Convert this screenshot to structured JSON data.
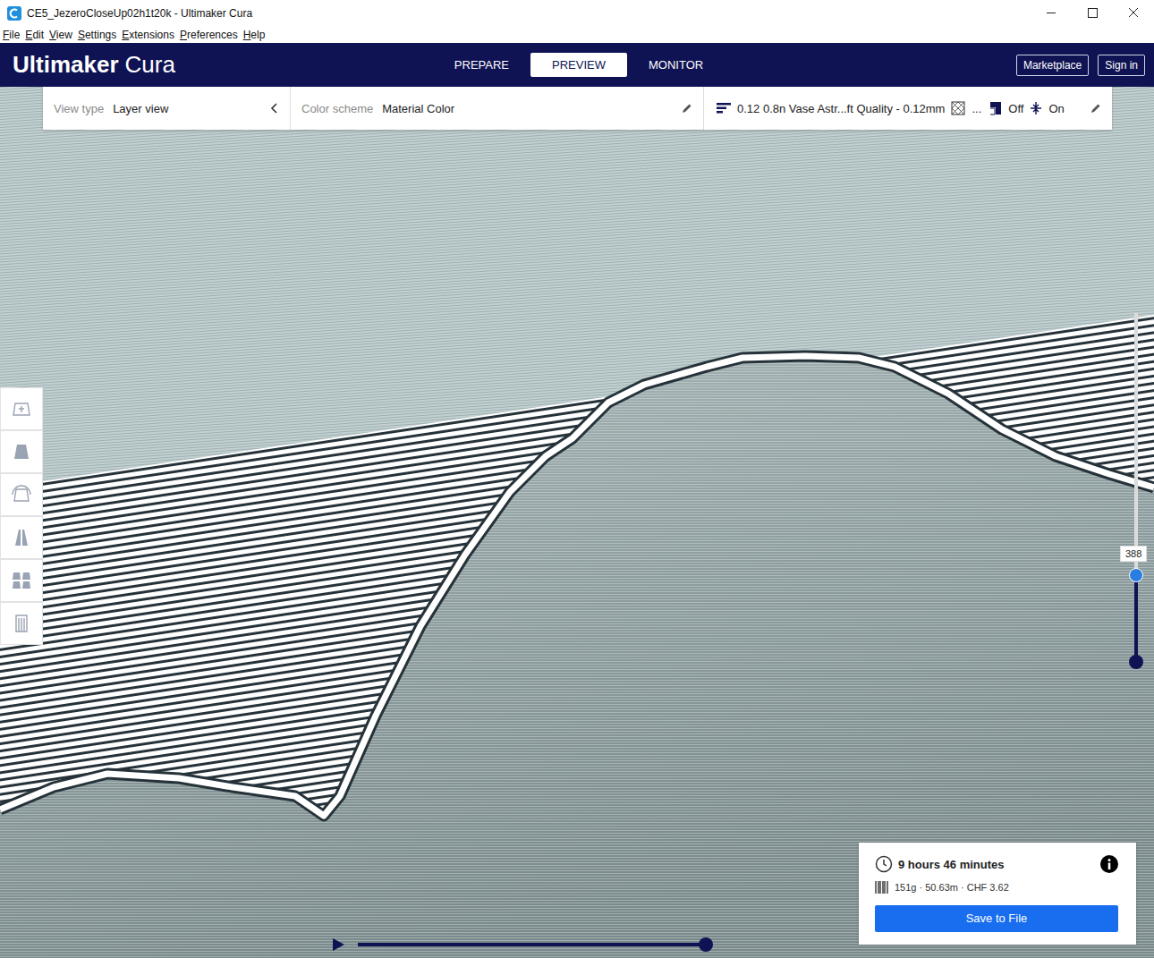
{
  "window": {
    "title": "CE5_JezeroCloseUp02h1t20k - Ultimaker Cura"
  },
  "menu": [
    "File",
    "Edit",
    "View",
    "Settings",
    "Extensions",
    "Preferences",
    "Help"
  ],
  "header": {
    "brand": "Ultimaker",
    "product": "Cura",
    "tabs": [
      {
        "label": "PREPARE",
        "selected": false
      },
      {
        "label": "PREVIEW",
        "selected": true
      },
      {
        "label": "MONITOR",
        "selected": false
      }
    ],
    "buttons": [
      "Marketplace",
      "Sign in"
    ]
  },
  "toolbar": {
    "view_type_label": "View type",
    "view_type": "Layer view",
    "color_scheme_label": "Color scheme",
    "color_scheme": "Material Color",
    "profile": "0.12 0.8n Vase Astr...ft Quality - 0.12mm",
    "infill": "...",
    "support": "Off",
    "adhesion": "On"
  },
  "tools": [
    {
      "kind": "move",
      "selected": false
    },
    {
      "kind": "scale",
      "selected": false
    },
    {
      "kind": "rotate",
      "selected": false
    },
    {
      "kind": "mirror",
      "selected": false
    },
    {
      "kind": "per-model",
      "selected": false
    },
    {
      "kind": "support-blocker",
      "selected": false
    }
  ],
  "layer_slider": {
    "value": "388",
    "level": 0.25
  },
  "playback": {
    "level": 1
  },
  "print_info": {
    "time": "9 hours 46 minutes",
    "material": "151g · 50.63m · CHF 3.62",
    "button": "Save to File"
  }
}
